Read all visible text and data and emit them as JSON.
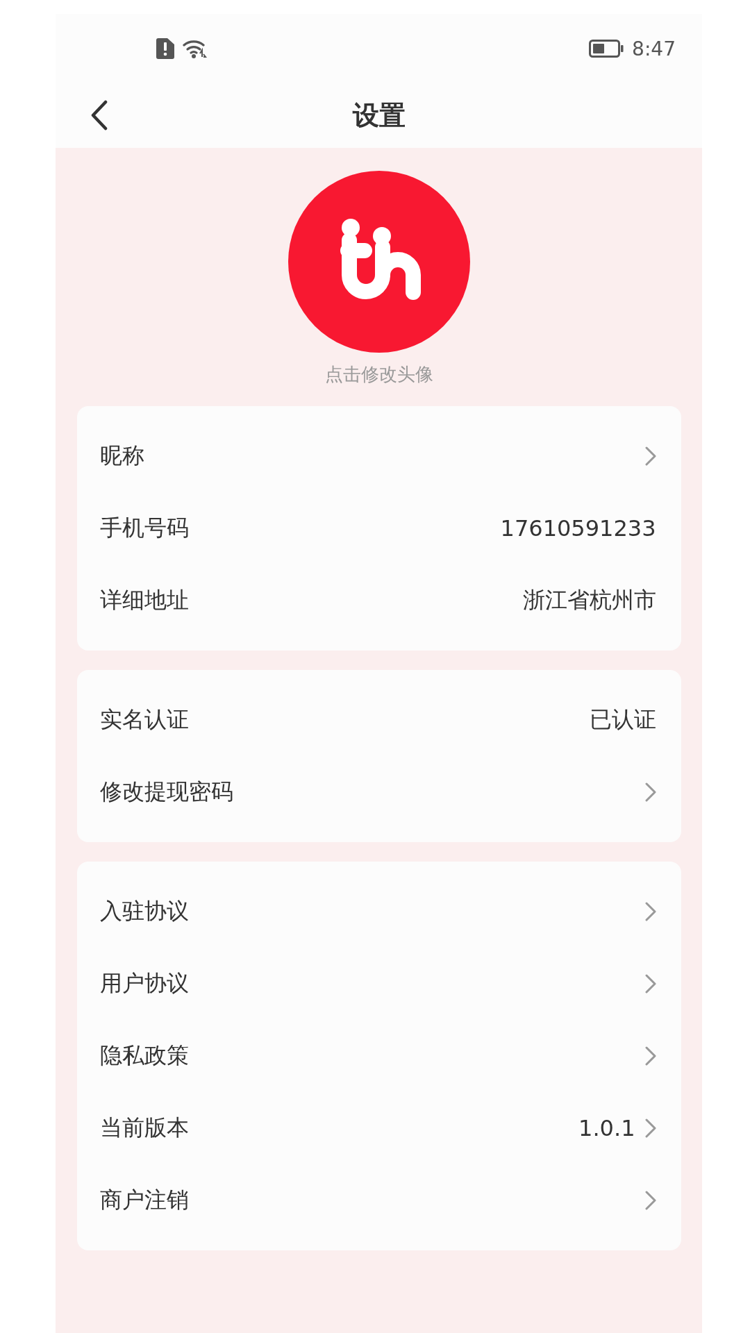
{
  "status_bar": {
    "time": "8:47"
  },
  "header": {
    "title": "设置"
  },
  "avatar": {
    "caption": "点击修改头像"
  },
  "groups": [
    {
      "rows": [
        {
          "label": "昵称",
          "arrow": true
        },
        {
          "label": "手机号码",
          "value": "17610591233",
          "arrow": false
        },
        {
          "label": "详细地址",
          "value": "浙江省杭州市",
          "arrow": false
        }
      ]
    },
    {
      "rows": [
        {
          "label": "实名认证",
          "value": "已认证",
          "arrow": false
        },
        {
          "label": "修改提现密码",
          "arrow": true
        }
      ]
    },
    {
      "rows": [
        {
          "label": "入驻协议",
          "arrow": true
        },
        {
          "label": "用户协议",
          "arrow": true
        },
        {
          "label": "隐私政策",
          "arrow": true
        },
        {
          "label": "当前版本",
          "value": "1.0.1",
          "arrow": true
        },
        {
          "label": "商户注销",
          "arrow": true
        }
      ]
    }
  ]
}
